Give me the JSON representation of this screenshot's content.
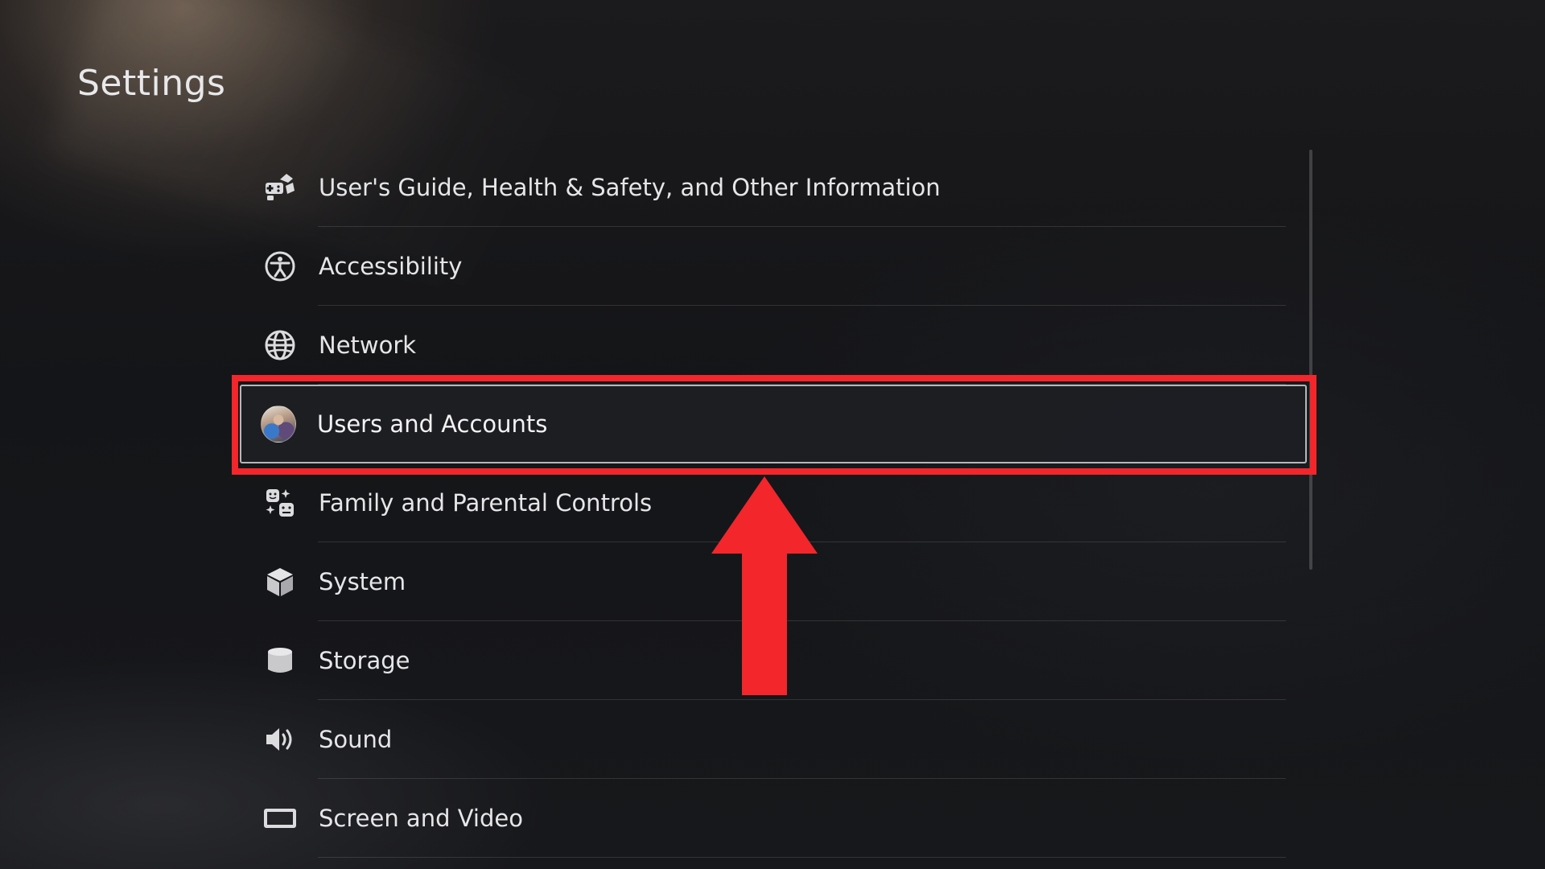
{
  "header": {
    "title": "Settings"
  },
  "menu": {
    "items": [
      {
        "label": "User's Guide, Health & Safety, and Other Information",
        "icon": "guide-icon"
      },
      {
        "label": "Accessibility",
        "icon": "accessibility-icon"
      },
      {
        "label": "Network",
        "icon": "globe-icon"
      },
      {
        "label": "Users and Accounts",
        "icon": "avatar-icon",
        "selected": true
      },
      {
        "label": "Family and Parental Controls",
        "icon": "family-icon"
      },
      {
        "label": "System",
        "icon": "cube-icon"
      },
      {
        "label": "Storage",
        "icon": "storage-icon"
      },
      {
        "label": "Sound",
        "icon": "speaker-icon"
      },
      {
        "label": "Screen and Video",
        "icon": "screen-icon"
      }
    ]
  },
  "annotation": {
    "highlight_color": "#f2262b",
    "arrow_color": "#f2262b",
    "highlighted_item": "Users and Accounts"
  },
  "colors": {
    "background": "#141518",
    "text": "#e6e6e8",
    "selection_border": "#d2d2d7"
  }
}
